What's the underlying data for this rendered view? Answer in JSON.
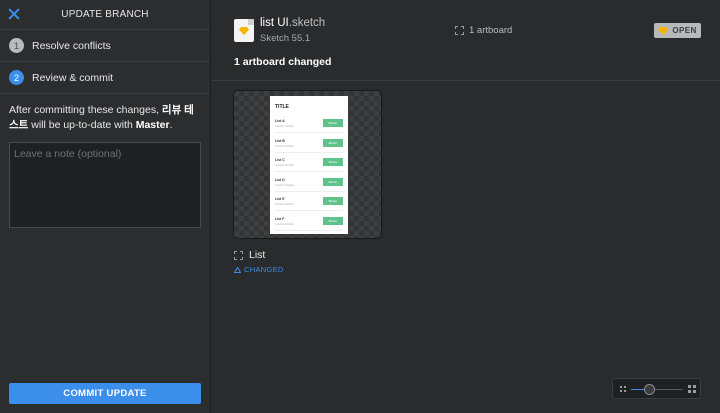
{
  "sidebar": {
    "title": "UPDATE BRANCH",
    "steps": [
      {
        "number": "1",
        "label": "Resolve conflicts",
        "state": "done"
      },
      {
        "number": "2",
        "label": "Review & commit",
        "state": "active"
      }
    ],
    "description": {
      "prefix": "After committing these changes, ",
      "branch": "리뷰 테스트",
      "middle": " will be up-to-date with ",
      "target": "Master",
      "suffix": "."
    },
    "note_placeholder": "Leave a note (optional)",
    "commit_label": "COMMIT UPDATE"
  },
  "file": {
    "name": "list UI",
    "extension": ".sketch",
    "version": "Sketch 55.1",
    "artboard_count": "1 artboard",
    "open_label": "OPEN"
  },
  "changes": {
    "header": "1 artboard changed",
    "artboards": [
      {
        "name": "List",
        "status": "CHANGED",
        "preview": {
          "title": "TITLE",
          "items": [
            {
              "name": "List A",
              "sub": "Subtitle blablah",
              "button": "Button"
            },
            {
              "name": "List B",
              "sub": "Subtitle blablah",
              "button": "Button"
            },
            {
              "name": "List C",
              "sub": "Subtitle blablah",
              "button": "Button"
            },
            {
              "name": "List D",
              "sub": "Subtitle blablah",
              "button": "Button"
            },
            {
              "name": "List E",
              "sub": "Subtitle blablah",
              "button": "Button"
            },
            {
              "name": "List F",
              "sub": "Subtitle blablah",
              "button": "Button"
            }
          ]
        }
      }
    ]
  },
  "zoom": {
    "level": 0.35
  },
  "colors": {
    "accent": "#3b8eea",
    "preview_button": "#5fc28b",
    "sketch_diamond": "#f7b500"
  }
}
